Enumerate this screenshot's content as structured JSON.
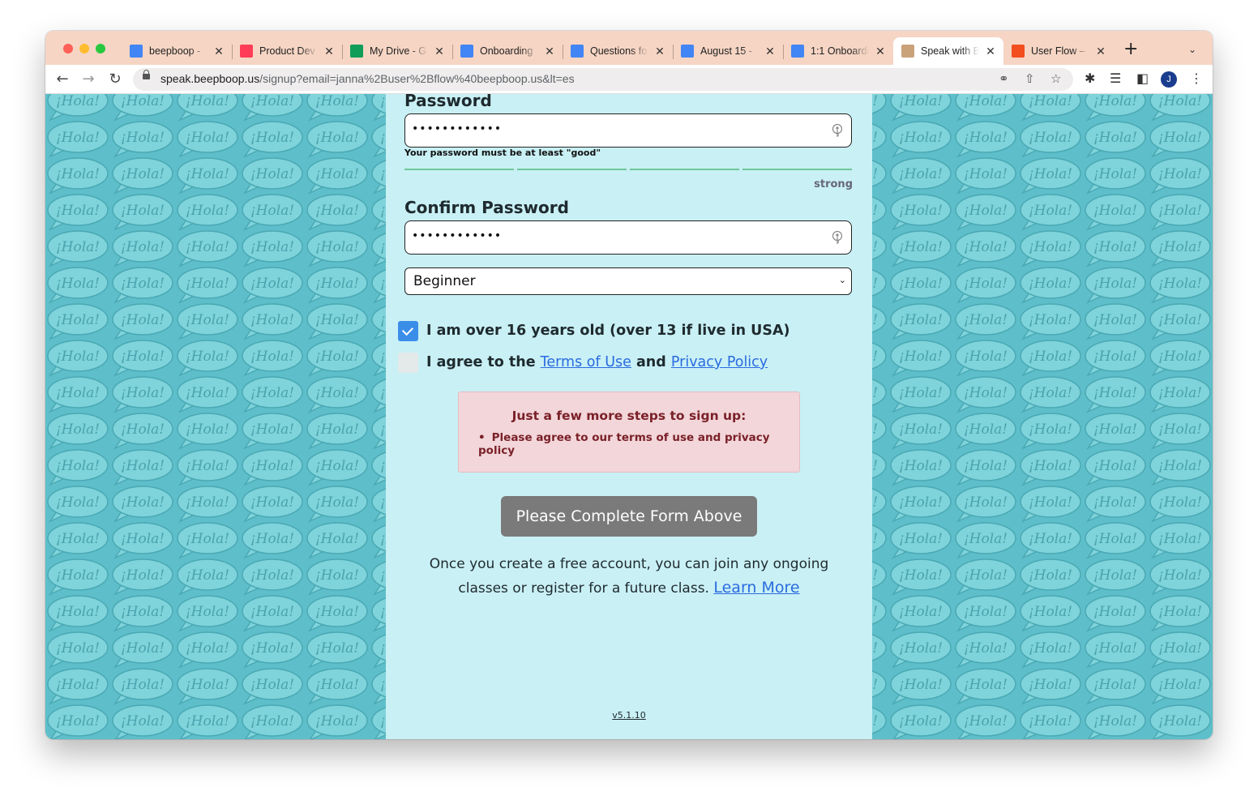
{
  "browser": {
    "tabs": [
      {
        "title": "beepboop - ",
        "favicon": "calendar-icon",
        "color": "#4285f4"
      },
      {
        "title": "Product Dev",
        "favicon": "monday-icon",
        "color": "#ff3d57"
      },
      {
        "title": "My Drive - G",
        "favicon": "google-drive-icon",
        "color": "#0f9d58"
      },
      {
        "title": "Onboarding",
        "favicon": "google-docs-icon",
        "color": "#4285f4"
      },
      {
        "title": "Questions fo",
        "favicon": "google-docs-icon",
        "color": "#4285f4"
      },
      {
        "title": "August 15 - ",
        "favicon": "google-docs-icon",
        "color": "#4285f4"
      },
      {
        "title": "1:1 Onboardi",
        "favicon": "google-docs-icon",
        "color": "#4285f4"
      },
      {
        "title": "Speak with B",
        "favicon": "speak-icon",
        "color": "#caa27a",
        "active": true
      },
      {
        "title": "User Flow – ",
        "favicon": "figma-icon",
        "color": "#f24e1e"
      }
    ],
    "new_tab": "+",
    "url_host": "speak.beepboop.us",
    "url_path": "/signup?email=janna%2Buser%2Bflow%40beepboop.us&lt=es",
    "profile_initial": "J"
  },
  "form": {
    "password_label": "Password",
    "password_value": "••••••••••••",
    "password_hint": "Your password must be at least \"good\"",
    "strength_label": "strong",
    "confirm_label": "Confirm Password",
    "confirm_value": "••••••••••••",
    "level_selected": "Beginner",
    "age_checkbox_label": "I am over 16 years old (over 13 if live in USA)",
    "age_checked": true,
    "agree_prefix": "I agree to the ",
    "terms_link": "Terms of Use",
    "agree_and": " and ",
    "privacy_link": "Privacy Policy",
    "agree_checked": false,
    "alert_title": "Just a few more steps to sign up:",
    "alert_item": "Please agree to our terms of use and privacy policy",
    "submit_label": "Please Complete Form Above",
    "info_text": "Once you create a free account, you can join any ongoing classes or register for a future class. ",
    "learn_more": "Learn More",
    "version": "v5.1.10"
  },
  "background": {
    "pattern_text": "¡Hola!",
    "color": "#5ebfca",
    "bubble_color": "#7fd3da",
    "panel_color": "#c9f0f5"
  }
}
